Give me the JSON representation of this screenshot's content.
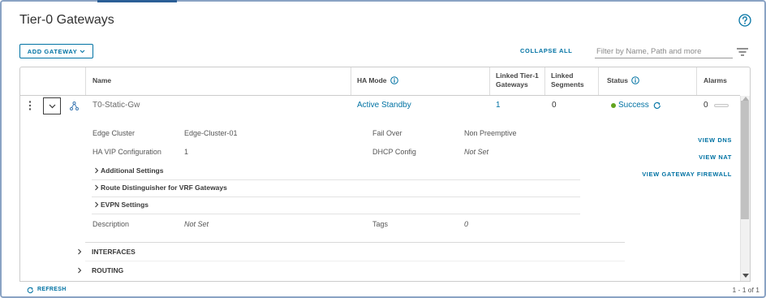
{
  "page": {
    "title": "Tier-0 Gateways"
  },
  "toolbar": {
    "add_gateway_label": "ADD GATEWAY",
    "collapse_all_label": "COLLAPSE ALL",
    "filter": {
      "placeholder": "Filter by Name, Path and more",
      "value": ""
    }
  },
  "table": {
    "headers": {
      "name": "Name",
      "ha_mode": "HA Mode",
      "linked_tier1_gateways": "Linked Tier-1 Gateways",
      "linked_segments": "Linked Segments",
      "status": "Status",
      "alarms": "Alarms"
    },
    "rows": [
      {
        "name": "T0-Static-Gw",
        "ha_mode": "Active Standby",
        "linked_tier1_gateways": "1",
        "linked_segments": "0",
        "status": "Success",
        "alarms": "0",
        "details": {
          "edge_cluster": {
            "label": "Edge Cluster",
            "value": "Edge-Cluster-01"
          },
          "fail_over": {
            "label": "Fail Over",
            "value": "Non Preemptive"
          },
          "ha_vip_configuration": {
            "label": "HA VIP Configuration",
            "value": "1"
          },
          "dhcp_config": {
            "label": "DHCP Config",
            "value": "Not Set"
          },
          "description": {
            "label": "Description",
            "value": "Not Set"
          },
          "tags": {
            "label": "Tags",
            "value": "0"
          },
          "sections": [
            "Additional Settings",
            "Route Distinguisher for VRF Gateways",
            "EVPN Settings"
          ],
          "actions": {
            "view_dns": "VIEW DNS",
            "view_nat": "VIEW NAT",
            "view_gateway_firewall": "VIEW GATEWAY FIREWALL"
          },
          "subsections": [
            "INTERFACES",
            "ROUTING"
          ]
        }
      }
    ]
  },
  "footer": {
    "refresh_label": "REFRESH",
    "pagination": "1 - 1 of 1"
  },
  "colors": {
    "accent": "#0072a3",
    "success": "#62a420",
    "border": "#cccccc",
    "text": "#565656",
    "heading": "#313131",
    "active_tab": "#2b5f96",
    "scrollbar_thumb": "#c1c1c1"
  },
  "icons": {
    "help": "help-circle-icon",
    "add_gateway_dropdown": "chevron-down-icon",
    "filter": "filter-icon",
    "row_actions": "kebab-menu-icon",
    "expand_row": "chevron-down-icon",
    "gateway": "tier0-gateway-icon",
    "column_info": "info-icon",
    "status_refresh": "refresh-icon",
    "section_toggle": "chevron-right-icon",
    "footer_refresh": "refresh-icon"
  }
}
